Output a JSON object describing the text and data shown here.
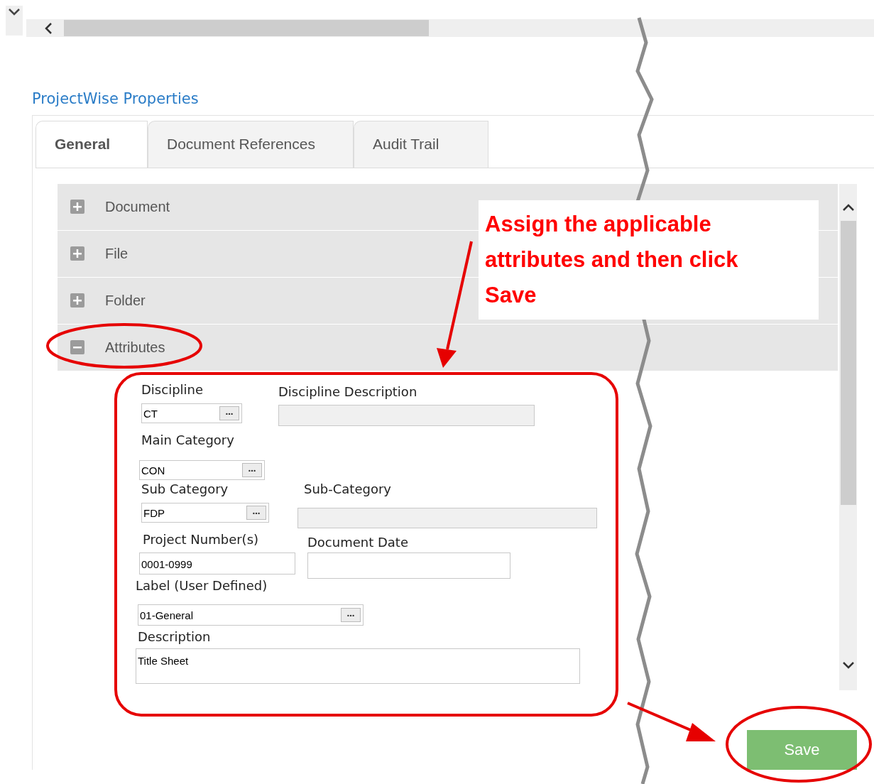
{
  "header": {
    "title": "ProjectWise Properties"
  },
  "tabs": [
    {
      "label": "General",
      "selected": true
    },
    {
      "label": "Document References",
      "selected": false
    },
    {
      "label": "Audit Trail",
      "selected": false
    }
  ],
  "sections": [
    {
      "label": "Document",
      "expanded": false
    },
    {
      "label": "File",
      "expanded": false
    },
    {
      "label": "Folder",
      "expanded": false
    },
    {
      "label": "Attributes",
      "expanded": true
    }
  ],
  "attributes": [
    {
      "label": "Discipline",
      "kind": "picker",
      "value": "CT"
    },
    {
      "label": "Discipline Description",
      "kind": "readonly"
    },
    {
      "label": "Main Category",
      "kind": "picker",
      "value": "CON"
    },
    {
      "label": "Sub Category",
      "kind": "picker",
      "value": "FDP"
    },
    {
      "label": "Sub-Category",
      "kind": "readonly"
    },
    {
      "label": "Project Number(s)",
      "kind": "text",
      "value": "0001-0999"
    },
    {
      "label": "Document Date",
      "kind": "text"
    },
    {
      "label": "Label (User Defined)",
      "kind": "picker",
      "value": "01-General"
    },
    {
      "label": "Description",
      "kind": "textarea",
      "value": "Title Sheet"
    }
  ],
  "save_button": {
    "label": "Save"
  },
  "callout": {
    "text": "Assign the applicable attributes and then click Save"
  }
}
